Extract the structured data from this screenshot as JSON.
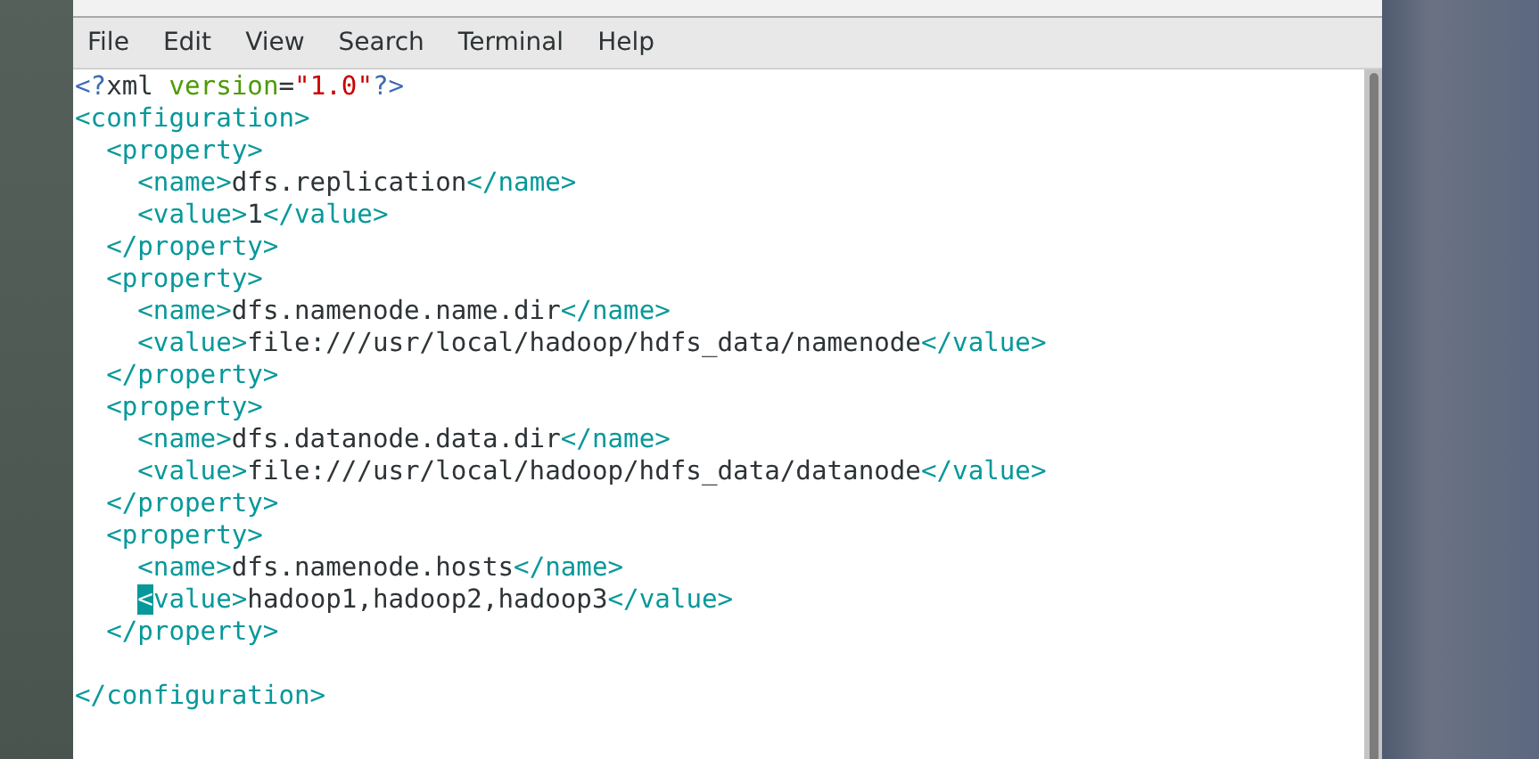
{
  "menu_bar": {
    "items": [
      "File",
      "Edit",
      "View",
      "Search",
      "Terminal",
      "Help"
    ]
  },
  "editor": {
    "lines": [
      {
        "kind": "code",
        "segments": [
          {
            "kind": "pi",
            "text": "<?"
          },
          {
            "kind": "plain",
            "text": "xml "
          },
          {
            "kind": "attr",
            "text": "version"
          },
          {
            "kind": "plain",
            "text": "="
          },
          {
            "kind": "string",
            "text": "\"1.0\""
          },
          {
            "kind": "pi",
            "text": "?>"
          }
        ]
      },
      {
        "kind": "code",
        "segments": [
          {
            "kind": "tag",
            "text": "<configuration>"
          }
        ]
      },
      {
        "kind": "code",
        "segments": [
          {
            "kind": "tag",
            "text": "  <property>"
          }
        ]
      },
      {
        "kind": "code",
        "segments": [
          {
            "kind": "tag",
            "text": "    <name>"
          },
          {
            "kind": "plain",
            "text": "dfs.replication"
          },
          {
            "kind": "tag",
            "text": "</name>"
          }
        ]
      },
      {
        "kind": "code",
        "segments": [
          {
            "kind": "tag",
            "text": "    <value>"
          },
          {
            "kind": "plain",
            "text": "1"
          },
          {
            "kind": "tag",
            "text": "</value>"
          }
        ]
      },
      {
        "kind": "code",
        "segments": [
          {
            "kind": "tag",
            "text": "  </property>"
          }
        ]
      },
      {
        "kind": "code",
        "segments": [
          {
            "kind": "tag",
            "text": "  <property>"
          }
        ]
      },
      {
        "kind": "code",
        "segments": [
          {
            "kind": "tag",
            "text": "    <name>"
          },
          {
            "kind": "plain",
            "text": "dfs.namenode.name.dir"
          },
          {
            "kind": "tag",
            "text": "</name>"
          }
        ]
      },
      {
        "kind": "code",
        "segments": [
          {
            "kind": "tag",
            "text": "    <value>"
          },
          {
            "kind": "plain",
            "text": "file:///usr/local/hadoop/hdfs_data/namenode"
          },
          {
            "kind": "tag",
            "text": "</value>"
          }
        ]
      },
      {
        "kind": "code",
        "segments": [
          {
            "kind": "tag",
            "text": "  </property>"
          }
        ]
      },
      {
        "kind": "code",
        "segments": [
          {
            "kind": "tag",
            "text": "  <property>"
          }
        ]
      },
      {
        "kind": "code",
        "segments": [
          {
            "kind": "tag",
            "text": "    <name>"
          },
          {
            "kind": "plain",
            "text": "dfs.datanode.data.dir"
          },
          {
            "kind": "tag",
            "text": "</name>"
          }
        ]
      },
      {
        "kind": "code",
        "segments": [
          {
            "kind": "tag",
            "text": "    <value>"
          },
          {
            "kind": "plain",
            "text": "file:///usr/local/hadoop/hdfs_data/datanode"
          },
          {
            "kind": "tag",
            "text": "</value>"
          }
        ]
      },
      {
        "kind": "code",
        "segments": [
          {
            "kind": "tag",
            "text": "  </property>"
          }
        ]
      },
      {
        "kind": "code",
        "segments": [
          {
            "kind": "tag",
            "text": "  <property>"
          }
        ]
      },
      {
        "kind": "code",
        "segments": [
          {
            "kind": "tag",
            "text": "    <name>"
          },
          {
            "kind": "plain",
            "text": "dfs.namenode.hosts"
          },
          {
            "kind": "tag",
            "text": "</name>"
          }
        ]
      },
      {
        "kind": "code",
        "segments": [
          {
            "kind": "cursor",
            "text": "    <"
          },
          {
            "kind": "tag",
            "text": "value>"
          },
          {
            "kind": "plain",
            "text": "hadoop1,hadoop2,hadoop3"
          },
          {
            "kind": "tag",
            "text": "</value>"
          }
        ]
      },
      {
        "kind": "code",
        "segments": [
          {
            "kind": "tag",
            "text": "  </property>"
          }
        ]
      },
      {
        "kind": "blank"
      },
      {
        "kind": "code",
        "segments": [
          {
            "kind": "tag",
            "text": "</configuration>"
          }
        ]
      }
    ]
  }
}
